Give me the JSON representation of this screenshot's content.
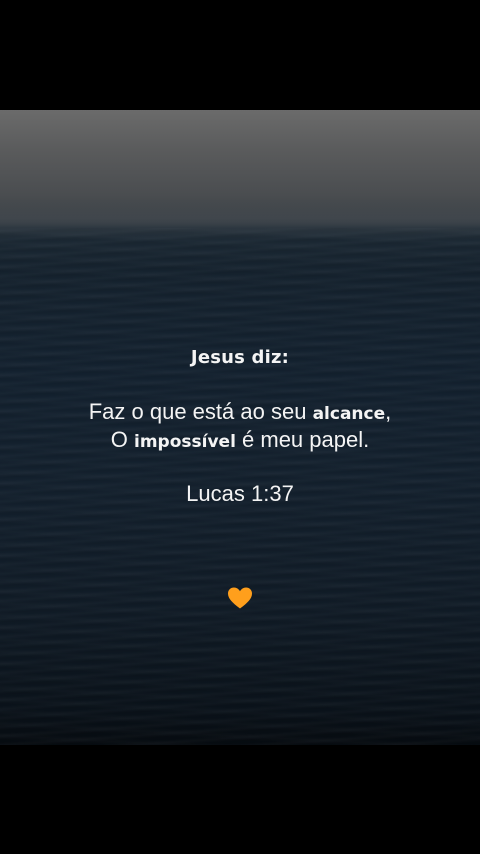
{
  "post": {
    "heading": "Jesus diz:",
    "quote_line1_pre": "Faz o que está ao seu ",
    "quote_line1_bold": "alcance",
    "quote_line1_post": ",",
    "quote_line2_pre": "O ",
    "quote_line2_bold": "impossível",
    "quote_line2_post": " é meu papel.",
    "reference": "Lucas 1:37",
    "heart_icon": "orange-heart-icon",
    "heart_color": "#ff9f1c"
  },
  "colors": {
    "sky": "#6b6b6b",
    "sea": "#14212e",
    "letterbox": "#000000",
    "text": "#f4f4f4"
  }
}
